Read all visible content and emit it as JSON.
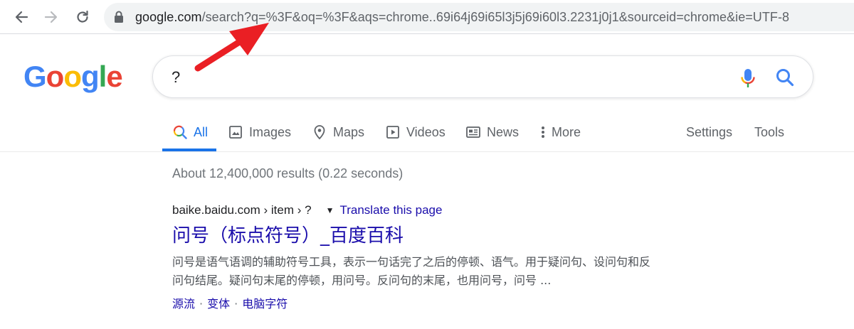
{
  "browser": {
    "url_host": "google.com",
    "url_rest": "/search?q=%3F&oq=%3F&aqs=chrome..69i64j69i65l3j5j69i60l3.2231j0j1&sourceid=chrome&ie=UTF-8"
  },
  "logo": {
    "g1": "G",
    "o1": "o",
    "o2": "o",
    "g2": "g",
    "l": "l",
    "e": "e"
  },
  "search": {
    "query": "?"
  },
  "tabs": {
    "all": "All",
    "images": "Images",
    "maps": "Maps",
    "videos": "Videos",
    "news": "News",
    "more": "More",
    "settings": "Settings",
    "tools": "Tools"
  },
  "results": {
    "stats": "About 12,400,000 results (0.22 seconds)",
    "items": [
      {
        "cite": "baike.baidu.com › item › ?",
        "translate": "Translate this page",
        "title": "问号（标点符号）_百度百科",
        "snippet_line1": "问号是语气语调的辅助符号工具，表示一句话完了之后的停顿、语气。用于疑问句、设问句和反",
        "snippet_line2": "问句结尾。疑问句末尾的停顿，用问号。反问句的末尾，也用问号，问号 ...",
        "sitelinks": [
          "源流",
          "变体",
          "电脑字符"
        ]
      }
    ]
  },
  "colors": {
    "link": "#1a0dab",
    "accent": "#1a73e8",
    "annotation_arrow": "#ea1f24"
  }
}
